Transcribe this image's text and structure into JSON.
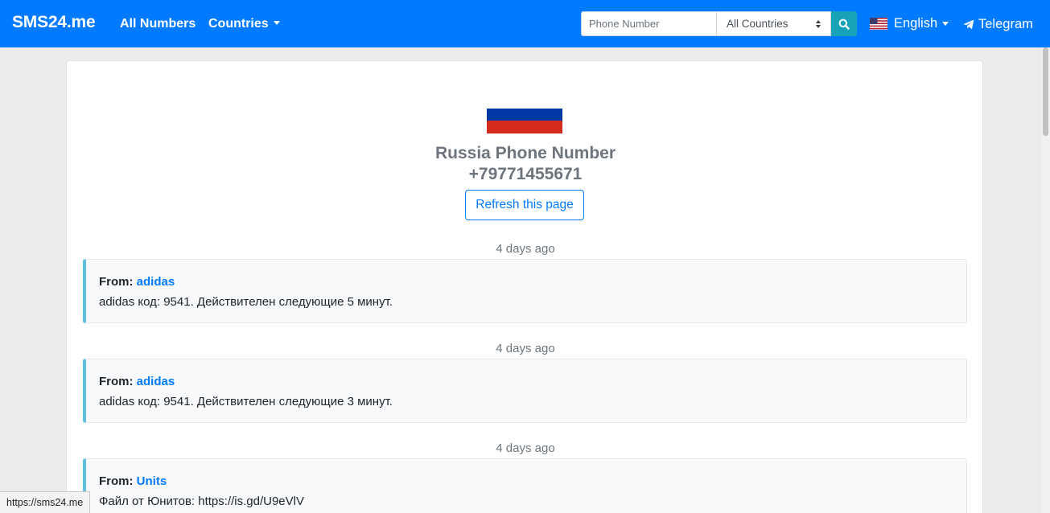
{
  "navbar": {
    "brand": "SMS24.me",
    "all_numbers": "All Numbers",
    "countries": "Countries",
    "search_placeholder": "Phone Number",
    "country_select": "All Countries",
    "language": "English",
    "telegram": "Telegram"
  },
  "page": {
    "title_line1": "Russia Phone Number",
    "title_line2": "+79771455671",
    "refresh_label": "Refresh this page"
  },
  "messages": [
    {
      "time": "4 days ago",
      "from_label": "From:",
      "sender": "adidas",
      "text": "adidas код: 9541. Действителен следующие 5 минут."
    },
    {
      "time": "4 days ago",
      "from_label": "From:",
      "sender": "adidas",
      "text": "adidas код: 9541. Действителен следующие 3 минут."
    },
    {
      "time": "4 days ago",
      "from_label": "From:",
      "sender": "Units",
      "text": "Файл от Юнитов: https://is.gd/U9eVlV"
    }
  ],
  "status_bar": "https://sms24.me",
  "colors": {
    "primary": "#007bff",
    "search_button": "#17a2b8",
    "message_accent": "#5bc0de"
  }
}
